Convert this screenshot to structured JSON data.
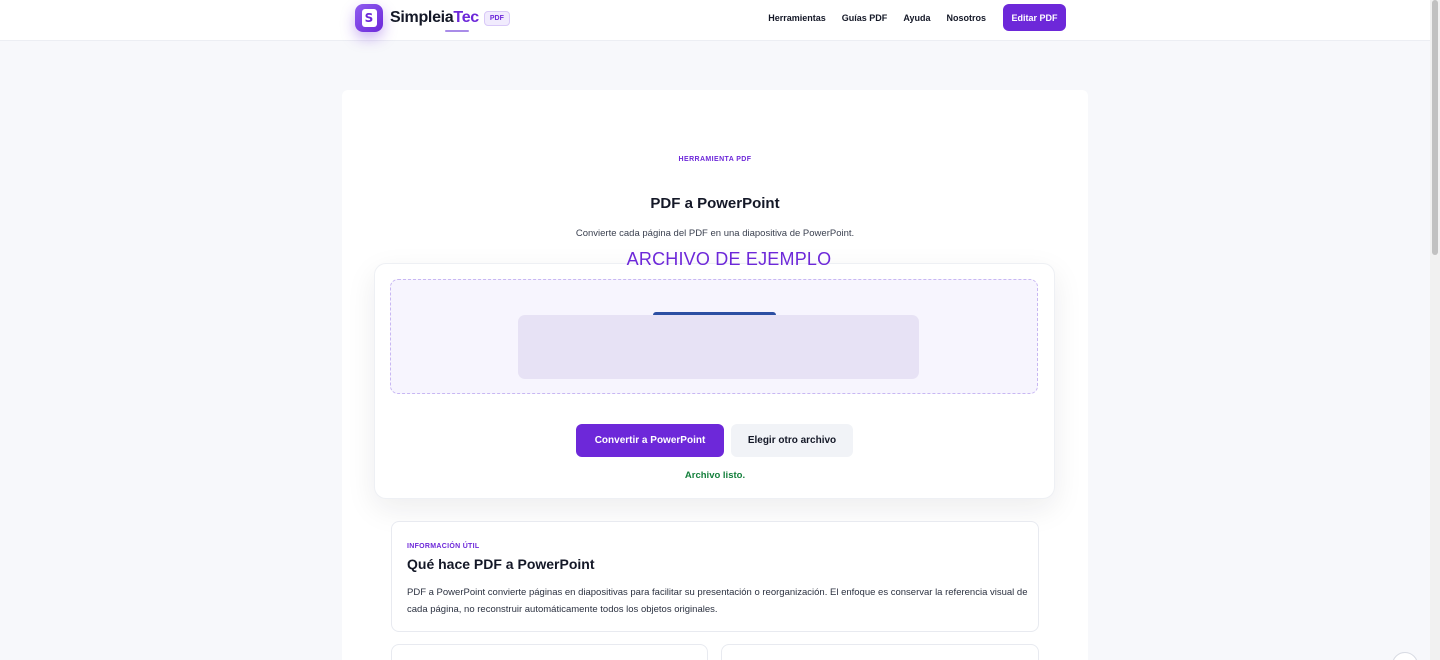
{
  "header": {
    "brand_part1": "Simpleia",
    "brand_part2": "Tec",
    "brand_badge": "PDF",
    "logo_letter": "S",
    "nav": [
      "Herramientas",
      "Guías PDF",
      "Ayuda",
      "Nosotros"
    ],
    "cta": "Editar PDF"
  },
  "tool": {
    "eyebrow": "HERRAMIENTA PDF",
    "title": "PDF a PowerPoint",
    "subtitle": "Convierte cada página del PDF en una diapositiva de PowerPoint.",
    "sample_label": "ARCHIVO DE EJEMPLO",
    "convert_button": "Convertir a PowerPoint",
    "choose_button": "Elegir otro archivo",
    "status": "Archivo listo."
  },
  "info": {
    "eyebrow": "INFORMACIÓN ÚTIL",
    "title": "Qué hace PDF a PowerPoint",
    "body": "PDF a PowerPoint convierte páginas en diapositivas para facilitar su presentación o reorganización. El enfoque es conservar la referencia visual de cada página, no reconstruir automáticamente todos los objetos originales."
  },
  "colors": {
    "accent": "#6d28d9",
    "status_green": "#15803d",
    "page_bg": "#f7f8fb"
  },
  "icons": {
    "logo": "document-s-logo-icon"
  }
}
